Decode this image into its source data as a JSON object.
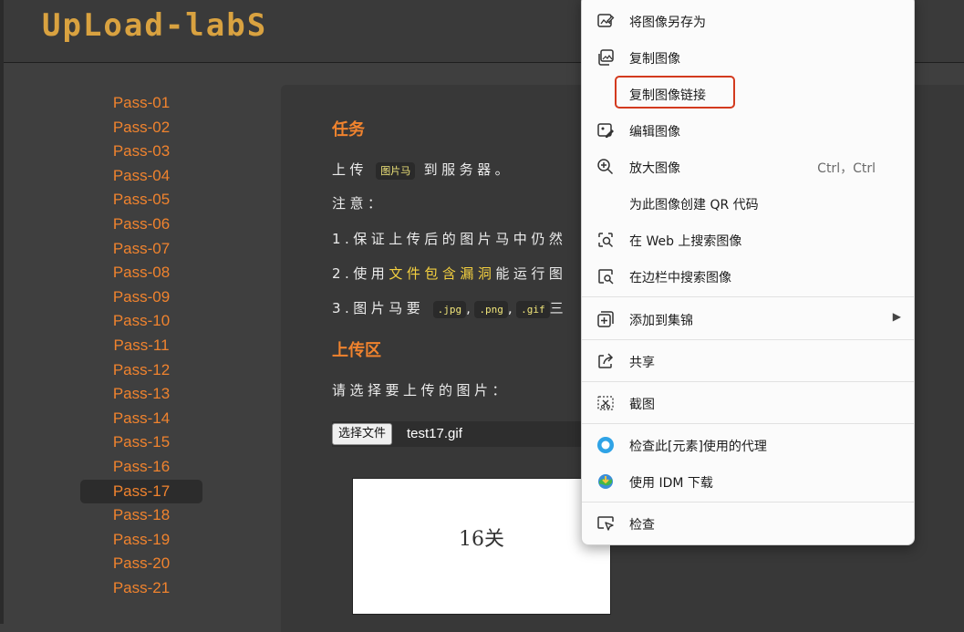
{
  "site": {
    "logo": "UpLoad-labS"
  },
  "sidebar": {
    "items": [
      "Pass-01",
      "Pass-02",
      "Pass-03",
      "Pass-04",
      "Pass-05",
      "Pass-06",
      "Pass-07",
      "Pass-08",
      "Pass-09",
      "Pass-10",
      "Pass-11",
      "Pass-12",
      "Pass-13",
      "Pass-14",
      "Pass-15",
      "Pass-16",
      "Pass-17",
      "Pass-18",
      "Pass-19",
      "Pass-20",
      "Pass-21"
    ],
    "active": "Pass-17"
  },
  "task": {
    "heading": "任务",
    "line1_pre": "上传",
    "line1_code": "图片马",
    "line1_post": "到服务器。",
    "note": "注意：",
    "item1": "1.保证上传后的图片马中仍然",
    "item2_pre": "2.使用",
    "item2_link": "文件包含漏洞",
    "item2_post": "能运行图",
    "item3_pre": "3.图片马要",
    "ext_jpg": ".jpg",
    "ext_png": ".png",
    "ext_gif": ".gif",
    "comma": ",",
    "item3_post": "三"
  },
  "upload": {
    "heading": "上传区",
    "prompt": "请选择要上传的图片：",
    "choose_button": "选择文件",
    "file_name": "test17.gif",
    "preview_text": "16关"
  },
  "context_menu": {
    "save_as": "将图像另存为",
    "copy_image": "复制图像",
    "copy_link": "复制图像链接",
    "edit_image": "编辑图像",
    "zoom_image": "放大图像",
    "zoom_shortcut": "Ctrl，Ctrl",
    "qr_code": "为此图像创建 QR 代码",
    "search_web": "在 Web 上搜索图像",
    "search_sidebar": "在边栏中搜索图像",
    "add_collection": "添加到集锦",
    "share": "共享",
    "screenshot": "截图",
    "check_proxy": "检查此[元素]使用的代理",
    "idm": "使用 IDM 下载",
    "inspect": "检查"
  },
  "colors": {
    "accent_orange": "#f0832e",
    "highlight_yellow": "#f4d03f",
    "red_box": "#d33a1e"
  }
}
